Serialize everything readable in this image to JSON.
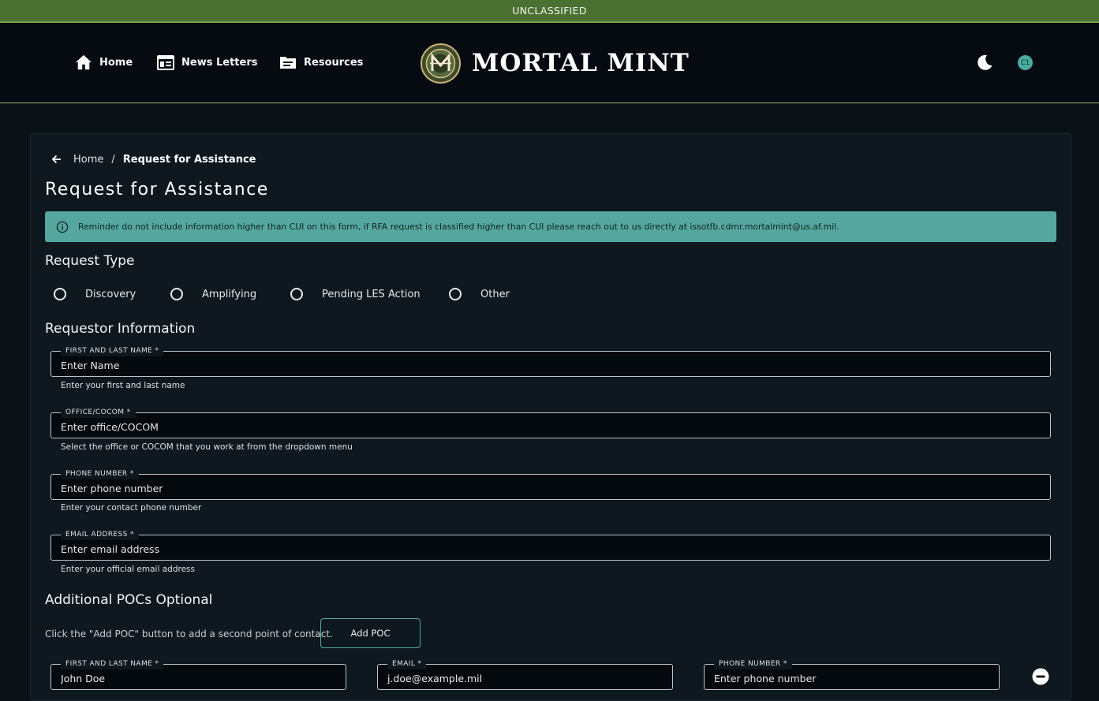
{
  "banner": {
    "text": "UNCLASSIFIED"
  },
  "nav": {
    "home": "Home",
    "newsletters": "News Letters",
    "resources": "Resources"
  },
  "brand": {
    "title": "MORTAL MINT",
    "logo_icon": "mortal-mint-logo"
  },
  "header_actions": {
    "theme_icon": "moon-icon",
    "avatar_initials": "C1"
  },
  "breadcrumb": {
    "home": "Home",
    "separator": "/",
    "current": "Request for Assistance"
  },
  "page": {
    "title": "Request for Assistance"
  },
  "alert": {
    "icon": "info-icon",
    "text": "Reminder do not include information higher than CUI on this form, if RFA request is classified higher than CUI please reach out to us directly at issotfb.cdmr.mortalmint@us.af.mil."
  },
  "request_type": {
    "heading": "Request Type",
    "options": [
      "Discovery",
      "Amplifying",
      "Pending LES Action",
      "Other"
    ]
  },
  "requestor": {
    "heading": "Requestor Information",
    "name": {
      "label": "FIRST AND LAST NAME *",
      "placeholder": "Enter Name",
      "help": "Enter your first and last name"
    },
    "office": {
      "label": "OFFICE/COCOM *",
      "placeholder": "Enter office/COCOM",
      "help": "Select the office or COCOM that  you work at from the dropdown menu"
    },
    "phone": {
      "label": "PHONE NUMBER *",
      "placeholder": "Enter phone number",
      "help": "Enter your contact phone number"
    },
    "email": {
      "label": "EMAIL ADDRESS *",
      "placeholder": "Enter email address",
      "help": "Enter your official email address"
    }
  },
  "pocs": {
    "heading": "Additional POCs Optional",
    "instructions": "Click the \"Add POC\" button to add a second point of contact.",
    "add_button": "Add POC",
    "row": {
      "name": {
        "label": "FIRST AND LAST NAME *",
        "value": "John Doe"
      },
      "email": {
        "label": "EMAIL *",
        "value": "j.doe@example.mil"
      },
      "phone": {
        "label": "PHONE NUMBER *",
        "placeholder": "Enter phone number"
      },
      "remove_icon": "remove-circle-icon"
    }
  },
  "colors": {
    "banner": "#4a7032",
    "alert": "#55a69e",
    "accent": "#4fa7a0",
    "background": "#0a1218"
  }
}
